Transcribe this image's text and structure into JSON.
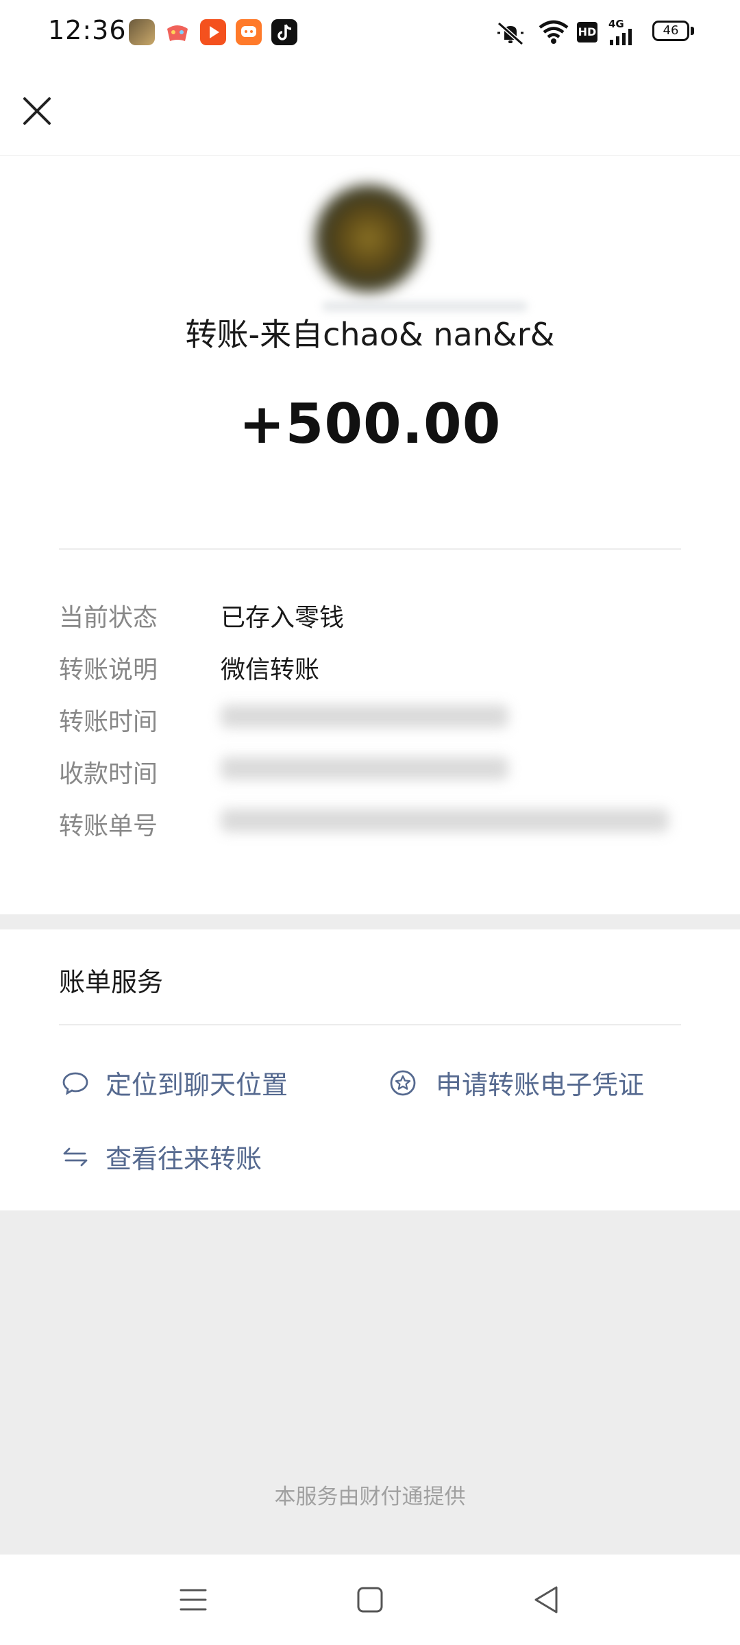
{
  "status_bar": {
    "time": "12:36",
    "battery": "46",
    "hd_label": "HD",
    "network": "4G",
    "app_icons": [
      "game-app-icon",
      "game-controller-app-icon",
      "video-play-app-icon",
      "orange-app-icon",
      "tiktok-app-icon"
    ]
  },
  "header": {
    "close_icon": "close-icon"
  },
  "transfer": {
    "title": "转账-来自chao& nan&r&",
    "amount": "+500.00"
  },
  "details": {
    "status": {
      "label": "当前状态",
      "value": "已存入零钱"
    },
    "note": {
      "label": "转账说明",
      "value": "微信转账"
    },
    "transfer_time": {
      "label": "转账时间"
    },
    "receive_time": {
      "label": "收款时间"
    },
    "transfer_id": {
      "label": "转账单号"
    }
  },
  "services": {
    "title": "账单服务",
    "locate_chat": "定位到聊天位置",
    "e_voucher": "申请转账电子凭证",
    "history": "查看往来转账"
  },
  "footer": {
    "text": "本服务由财付通提供"
  },
  "colors": {
    "link": "#55698f",
    "gray_bg": "#ededed",
    "label_gray": "#888888"
  }
}
